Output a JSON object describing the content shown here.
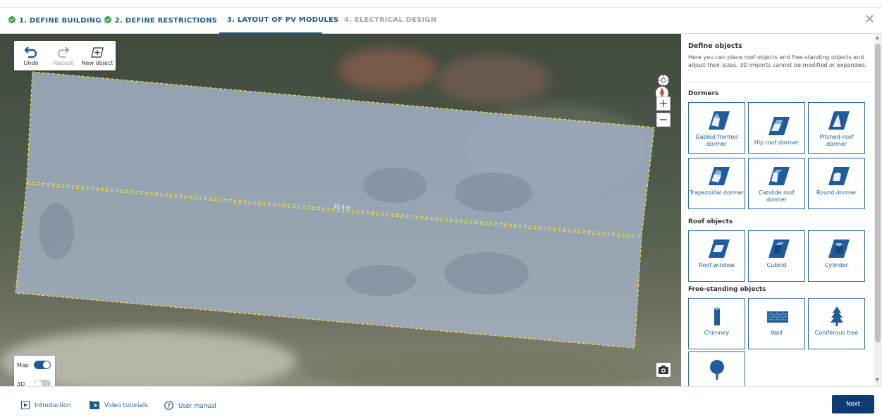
{
  "steps": [
    {
      "label": "1. DEFINE BUILDING",
      "state": "done"
    },
    {
      "label": "2. DEFINE RESTRICTIONS",
      "state": "done"
    },
    {
      "label": "3. LAYOUT OF PV MODULES",
      "state": "active"
    },
    {
      "label": "4. ELECTRICAL DESIGN",
      "state": "disabled"
    }
  ],
  "close_icon": "close-icon",
  "toolbar": {
    "undo_label": "Undo",
    "repeat_label": "Repeat",
    "new_object_label": "New object"
  },
  "map": {
    "measurement_label": "35.6 m",
    "compass_label": "N",
    "zoom_in": "+",
    "zoom_out": "−",
    "view_toggles": {
      "map_label": "Map",
      "map_on": true,
      "threed_label": "3D",
      "threed_on": false
    }
  },
  "panel": {
    "title": "Define objects",
    "description": "Here you can place roof objects and free-standing objects and adjust their sizes. 3D imports cannot be modified or expanded.",
    "sections": [
      {
        "title": "Dormers",
        "items": [
          {
            "label": "Gabled fronted dormer",
            "icon": "gabled-fronted-dormer-icon"
          },
          {
            "label": "Hip roof dormer",
            "icon": "hip-roof-dormer-icon"
          },
          {
            "label": "Pitched-roof dormer",
            "icon": "pitched-roof-dormer-icon"
          },
          {
            "label": "Trapezoidal dormer",
            "icon": "trapezoidal-dormer-icon"
          },
          {
            "label": "Catslide roof dormer",
            "icon": "catslide-roof-dormer-icon"
          },
          {
            "label": "Round dormer",
            "icon": "round-dormer-icon"
          }
        ]
      },
      {
        "title": "Roof objects",
        "items": [
          {
            "label": "Roof window",
            "icon": "roof-window-icon"
          },
          {
            "label": "Cuboid",
            "icon": "cuboid-icon"
          },
          {
            "label": "Cylinder",
            "icon": "cylinder-icon"
          }
        ]
      },
      {
        "title": "Free-standing objects",
        "items": [
          {
            "label": "Chimney",
            "icon": "chimney-icon"
          },
          {
            "label": "Wall",
            "icon": "wall-icon"
          },
          {
            "label": "Coniferous tree",
            "icon": "coniferous-tree-icon"
          },
          {
            "label": "",
            "icon": "deciduous-tree-icon"
          }
        ]
      }
    ]
  },
  "footer": {
    "links": [
      {
        "label": "Introduction",
        "icon": "play-icon"
      },
      {
        "label": "Video tutorials",
        "icon": "video-icon"
      },
      {
        "label": "User manual",
        "icon": "help-icon"
      }
    ],
    "next_label": "Next"
  },
  "colors": {
    "brand_blue": "#1b5e93",
    "done_green": "#3aa346",
    "next_button": "#103a73",
    "tile_border": "#2c6aa5",
    "roof_overlay": "#aab9cf"
  }
}
